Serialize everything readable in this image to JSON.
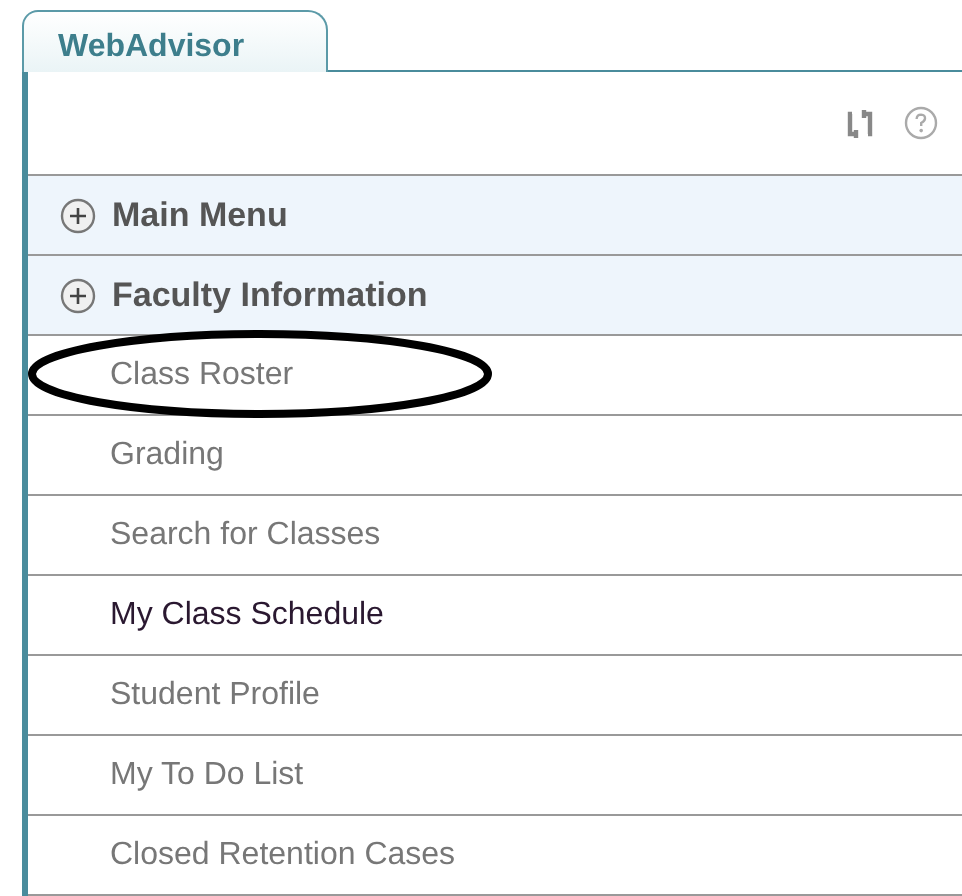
{
  "tab": {
    "label": "WebAdvisor",
    "selected": true
  },
  "sections": [
    {
      "label": "Main Menu",
      "expanded": false
    },
    {
      "label": "Faculty Information",
      "expanded": false
    }
  ],
  "items": [
    {
      "label": "Class Roster",
      "visited": false,
      "circled": true
    },
    {
      "label": "Grading",
      "visited": false,
      "circled": false
    },
    {
      "label": "Search for Classes",
      "visited": false,
      "circled": false
    },
    {
      "label": "My Class Schedule",
      "visited": true,
      "circled": false
    },
    {
      "label": "Student Profile",
      "visited": false,
      "circled": false
    },
    {
      "label": "My To Do List",
      "visited": false,
      "circled": false
    },
    {
      "label": "Closed Retention Cases",
      "visited": false,
      "circled": false
    }
  ]
}
